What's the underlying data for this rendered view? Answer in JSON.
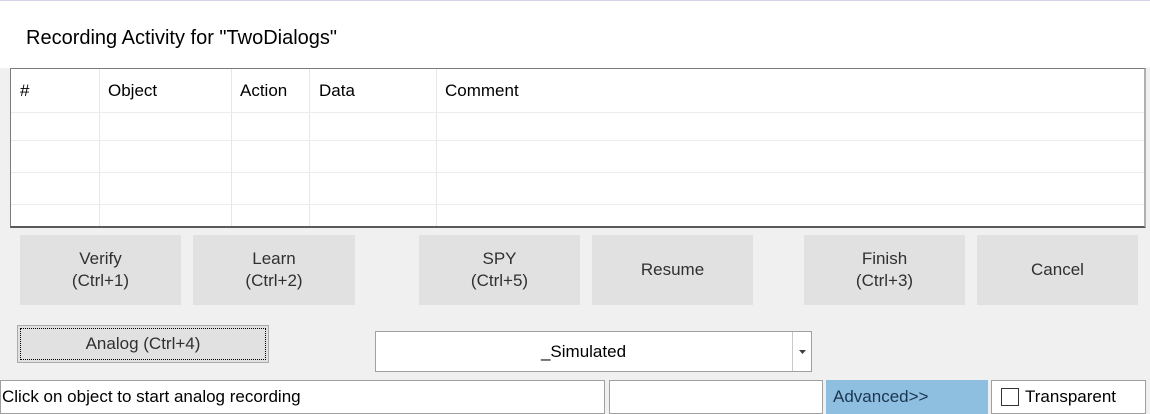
{
  "window": {
    "title": "Recording Activity for \"TwoDialogs\""
  },
  "grid": {
    "columns": [
      "#",
      "Object",
      "Action",
      "Data",
      "Comment"
    ],
    "rows": []
  },
  "buttons": {
    "verify": {
      "line1": "Verify",
      "line2": "(Ctrl+1)"
    },
    "learn": {
      "line1": "Learn",
      "line2": "(Ctrl+2)"
    },
    "spy": {
      "line1": "SPY",
      "line2": "(Ctrl+5)"
    },
    "resume": "Resume",
    "finish": {
      "line1": "Finish",
      "line2": "(Ctrl+3)"
    },
    "cancel": "Cancel",
    "analog": "Analog (Ctrl+4)"
  },
  "mode_select": {
    "selected": "_Simulated"
  },
  "status_bar": {
    "message": "Click on object to start analog recording",
    "secondary": "",
    "advanced_label": "Advanced>>",
    "transparent_label": "Transparent",
    "transparent_checked": false
  },
  "colors": {
    "advanced_bg": "#8ebfe0",
    "button_bg": "#e1e1e1"
  }
}
